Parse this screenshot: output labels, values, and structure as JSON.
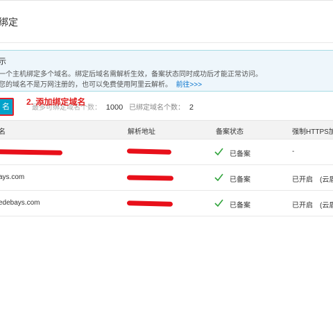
{
  "header": {
    "title": "绑定"
  },
  "notice": {
    "title": "示",
    "line1": "一个主机绑定多个域名。绑定后域名需解析生效，备案状态同时成功后才能正常访问。",
    "line2_text": "您的域名不是万网注册的，也可以免费使用阿里云解析。",
    "line2_link": "前往>>>"
  },
  "toolbar": {
    "add_button_label": "名",
    "annotation": "2. 添加绑定域名",
    "max_label": "最多可绑定域名个数：",
    "max_value": "1000",
    "bound_label": "已绑定域名个数：",
    "bound_value": "2"
  },
  "table": {
    "columns": [
      "名",
      "解析地址",
      "备案状态",
      "强制HTTPS加"
    ],
    "rows": [
      {
        "domain": "",
        "status": "已备案",
        "https": "-"
      },
      {
        "domain": "ays.com",
        "status": "已备案",
        "https": "已开启　(云盾"
      },
      {
        "domain": "edebays.com",
        "status": "已备案",
        "https": "已开启　(云盾"
      }
    ]
  },
  "colors": {
    "accent": "#00a2ca",
    "annotation": "#e02020",
    "check": "#2fa33a",
    "link": "#0070cc"
  }
}
